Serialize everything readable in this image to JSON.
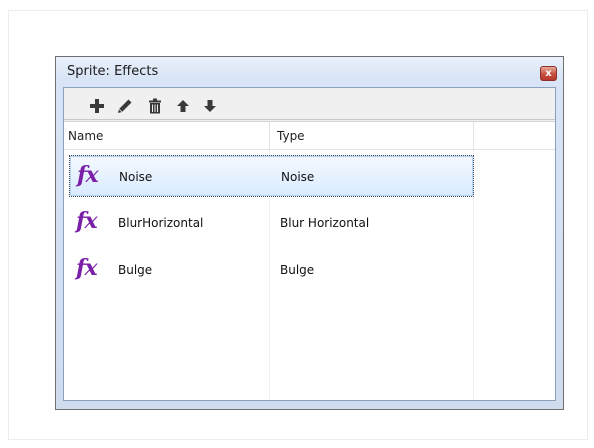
{
  "dialog": {
    "title": "Sprite: Effects",
    "close_glyph": "x"
  },
  "toolbar": {
    "buttons": [
      {
        "icon": "add-icon",
        "label": "Add"
      },
      {
        "icon": "pencil-icon",
        "label": "Edit"
      },
      {
        "icon": "trash-icon",
        "label": "Delete"
      },
      {
        "icon": "arrow-up-icon",
        "label": "Move Up"
      },
      {
        "icon": "arrow-down-icon",
        "label": "Move Down"
      }
    ]
  },
  "list": {
    "columns": [
      "Name",
      "Type"
    ],
    "icon_text": "fx",
    "selected_index": 0,
    "rows": [
      {
        "name": "Noise",
        "type": "Noise"
      },
      {
        "name": "BlurHorizontal",
        "type": "Blur Horizontal"
      },
      {
        "name": "Bulge",
        "type": "Bulge"
      }
    ]
  },
  "colors": {
    "fx_icon": "#7a1fa8",
    "selection": "#d9ebff",
    "close_button": "#c7503f"
  }
}
